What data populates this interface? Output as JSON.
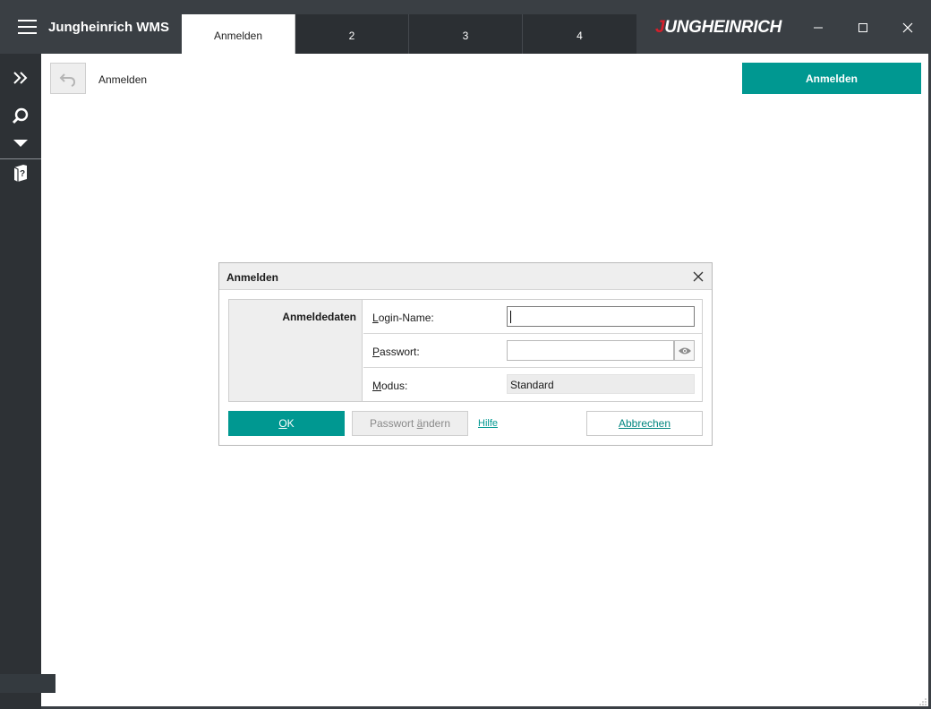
{
  "app": {
    "title": "Jungheinrich WMS",
    "brand": {
      "initial": "J",
      "rest": "UNGHEINRICH",
      "color": "#d81e2a"
    }
  },
  "tabs": [
    {
      "label": "Anmelden",
      "active": true
    },
    {
      "label": "2"
    },
    {
      "label": "3"
    },
    {
      "label": "4"
    }
  ],
  "window_controls": [
    "minimize-icon",
    "maximize-icon",
    "close-icon"
  ],
  "sidebar": {
    "icons": [
      "double-chevron-right-icon",
      "search-icon",
      "caret-down-icon",
      "help-book-icon"
    ]
  },
  "toolbar": {
    "page_title": "Anmelden",
    "primary_action": "Anmelden",
    "accent_color": "#009891"
  },
  "dialog": {
    "title": "Anmelden",
    "section_label": "Anmeldedaten",
    "fields": {
      "login": {
        "mnemonic": "L",
        "label_rest": "ogin-Name:",
        "value": ""
      },
      "password": {
        "mnemonic": "P",
        "label_rest": "asswort:",
        "value": ""
      },
      "mode": {
        "mnemonic": "M",
        "label_rest": "odus:",
        "value": "Standard"
      }
    },
    "buttons": {
      "ok": {
        "mnemonic": "O",
        "rest": "K"
      },
      "change_password": {
        "prefix": "Passwort ",
        "mnemonic": "ä",
        "rest": "ndern"
      },
      "help": "Hilfe",
      "cancel": {
        "mnemonic": "A",
        "rest": "bbrechen"
      }
    }
  }
}
